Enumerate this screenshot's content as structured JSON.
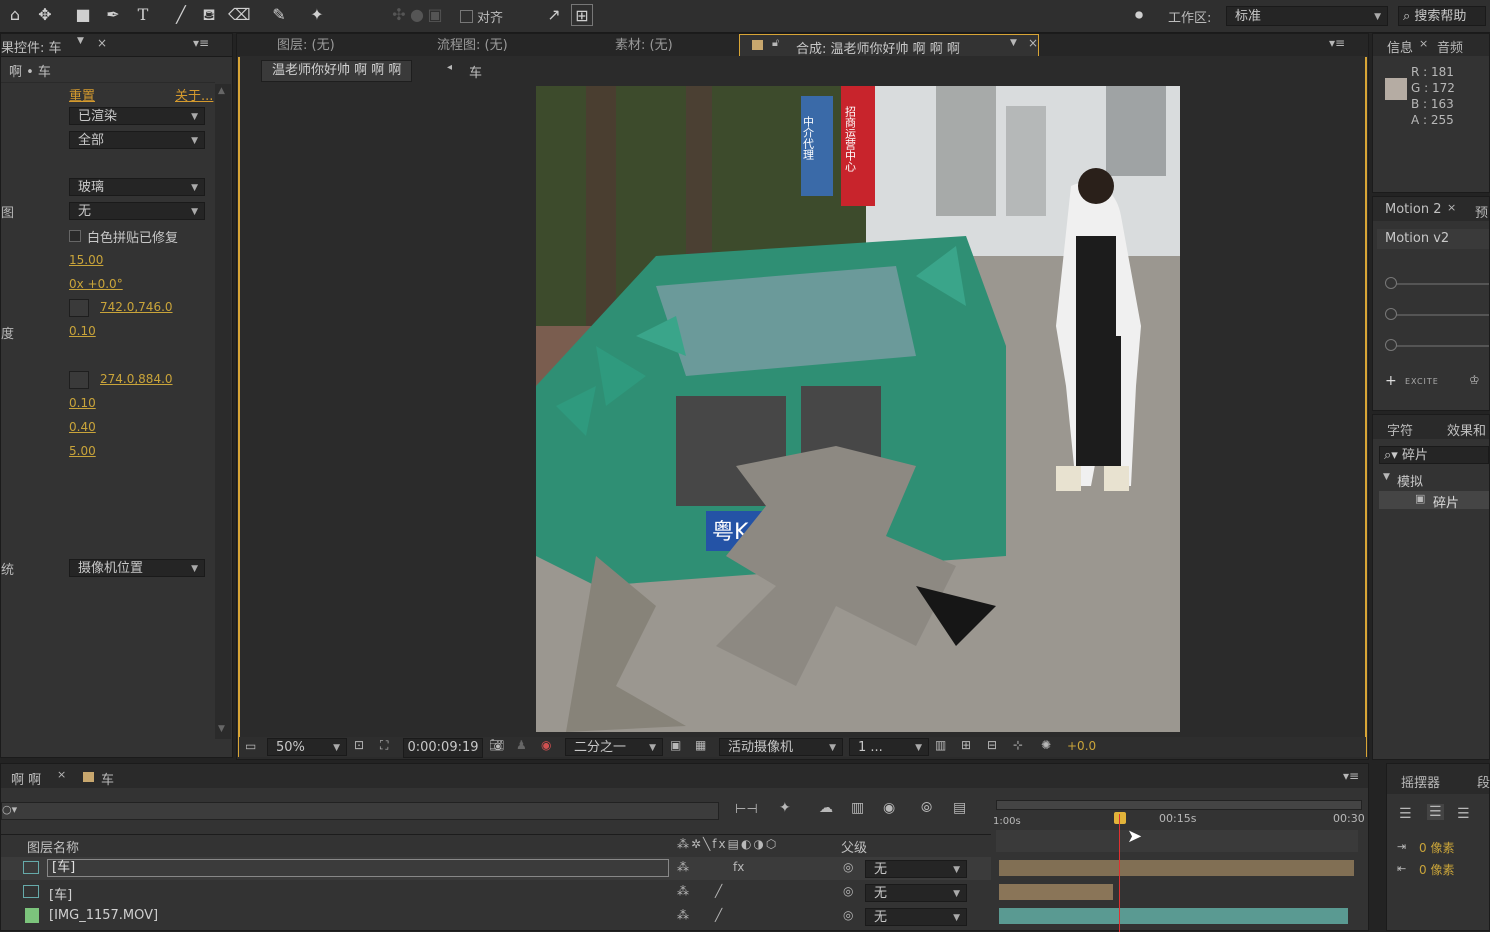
{
  "toolbar": {
    "align_label": "对齐",
    "workspace_label": "工作区:",
    "workspace_value": "标准",
    "search_help": "搜索帮助"
  },
  "effects_panel": {
    "tab_title": "果控件: 车",
    "breadcrumb": "啊 • 车",
    "reset": "重置",
    "about": "关于...",
    "render_mode": "已渲染",
    "all": "全部",
    "glass": "玻璃",
    "map_label": "图",
    "map_value": "无",
    "checkbox_label": "白色拼贴已修复",
    "v1": "15.00",
    "v2": "0x +0.0°",
    "point1": "742.0,746.0",
    "degree_label": "度",
    "v3": "0.10",
    "point2": "274.0,884.0",
    "v4": "0.10",
    "v5": "0.40",
    "v6": "5.00",
    "camera_prefix": "统",
    "camera_value": "摄像机位置"
  },
  "viewer": {
    "tabs": [
      "图层: (无)",
      "流程图: (无)",
      "素材: (无)"
    ],
    "comp_tab": "合成: 温老师你好帅 啊  啊  啊",
    "comp_name": "温老师你好帅 啊  啊  啊",
    "layer_crumb": "车",
    "zoom": "50%",
    "timecode": "0:00:09:19",
    "resolution": "二分之一",
    "camera": "活动摄像机",
    "views": "1 ...",
    "exposure": "+0.0",
    "plate_text": "粤K·B 001B",
    "banner1": "中介代理",
    "banner2": "招商运营中心"
  },
  "info_panel": {
    "tab_info": "信息",
    "tab_audio": "音频",
    "r": "R : 181",
    "g": "G : 172",
    "b": "B : 163",
    "a": "A : 255",
    "swatch": "#b5aca3"
  },
  "motion_panel": {
    "tab": "Motion 2",
    "tab2": "预",
    "title": "Motion v2",
    "excite": "EXCITE"
  },
  "effects_presets": {
    "tab_char": "字符",
    "tab_effects": "效果和",
    "search": "碎片",
    "group": "模拟",
    "item": "碎片"
  },
  "timeline": {
    "tab1": "啊 啊",
    "tab2": "车",
    "col_name": "图层名称",
    "col_parent": "父级",
    "ruler": [
      "1:00s",
      "00:15s",
      "00:30"
    ],
    "layers": [
      {
        "name": "[车]",
        "parent": "无"
      },
      {
        "name": "[车]",
        "parent": "无"
      },
      {
        "name": "[IMG_1157.MOV]",
        "parent": "无"
      }
    ]
  },
  "paragraph_panel": {
    "tab": "摇摆器",
    "tab2": "段",
    "px1": "0 像素",
    "px2": "0 像素"
  }
}
